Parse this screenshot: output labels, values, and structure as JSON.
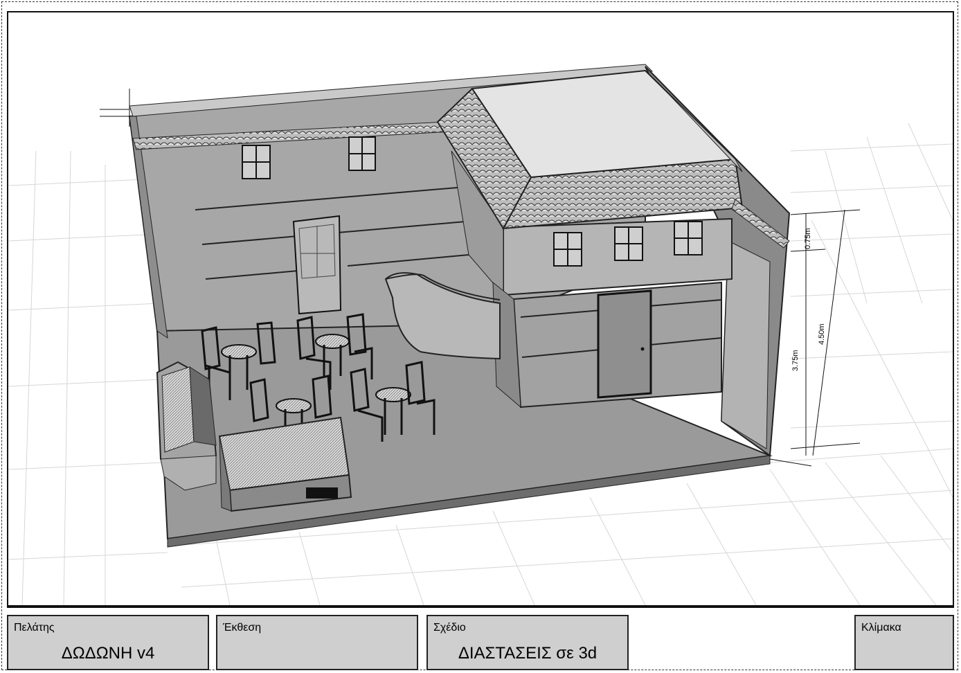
{
  "viewport": {
    "dimensions": {
      "height_top": "0.75m",
      "height_total": "4.50m",
      "height_lower": "3.75m"
    }
  },
  "titleblock": {
    "client": {
      "label": "Πελάτης",
      "value": "ΔΩΔΩΝΗ v4"
    },
    "exhibition": {
      "label": "Έκθεση",
      "value": ""
    },
    "drawing": {
      "label": "Σχέδιο",
      "value": "ΔΙΑΣΤΑΣΕΙΣ σε 3d"
    },
    "scale": {
      "label": "Κλίμακα",
      "value": ""
    }
  }
}
